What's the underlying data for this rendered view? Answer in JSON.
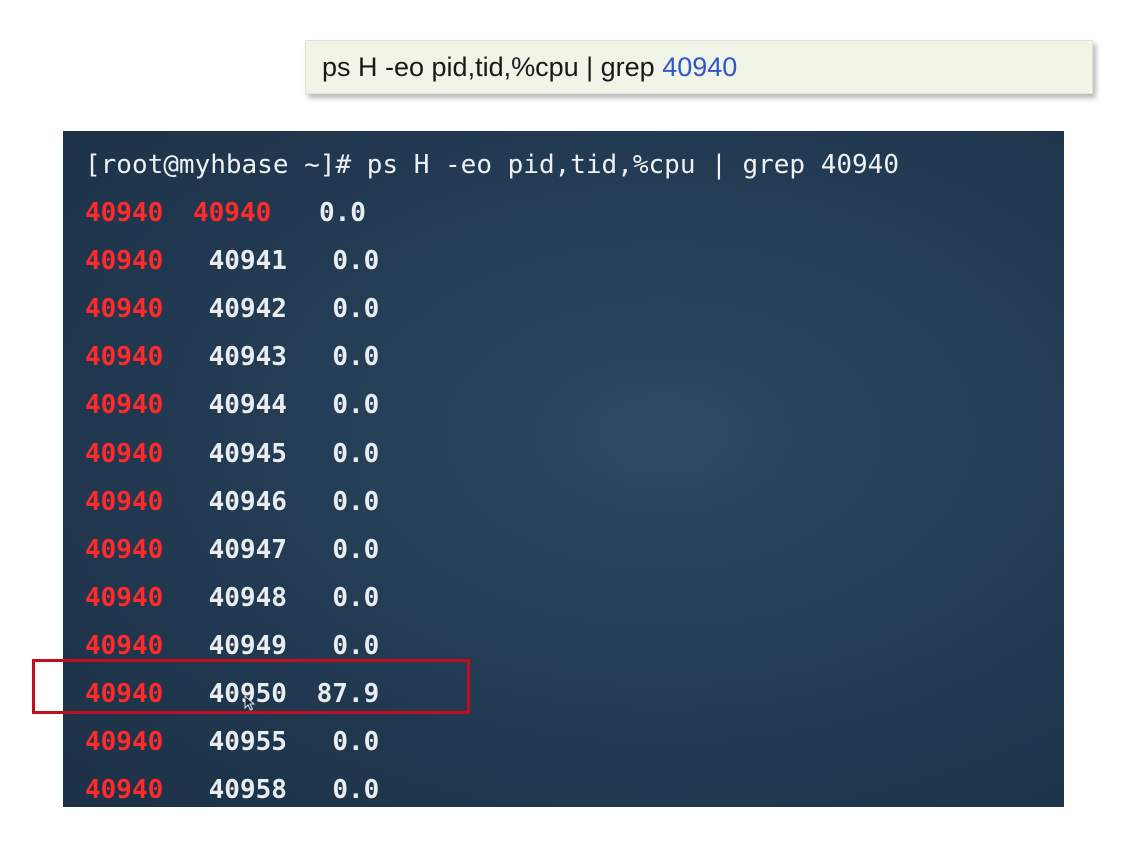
{
  "command_box": {
    "prefix": "ps H -eo pid,tid,%cpu | grep ",
    "highlight": "40940"
  },
  "terminal": {
    "prompt": "[root@myhbase ~]# ps H -eo pid,tid,%cpu | grep 40940",
    "rows": [
      {
        "pid": "40940",
        "tid": "40940",
        "cpu": "0.0",
        "tid_red": true
      },
      {
        "pid": "40940",
        "tid": "40941",
        "cpu": "0.0"
      },
      {
        "pid": "40940",
        "tid": "40942",
        "cpu": "0.0"
      },
      {
        "pid": "40940",
        "tid": "40943",
        "cpu": "0.0"
      },
      {
        "pid": "40940",
        "tid": "40944",
        "cpu": "0.0"
      },
      {
        "pid": "40940",
        "tid": "40945",
        "cpu": "0.0"
      },
      {
        "pid": "40940",
        "tid": "40946",
        "cpu": "0.0"
      },
      {
        "pid": "40940",
        "tid": "40947",
        "cpu": "0.0"
      },
      {
        "pid": "40940",
        "tid": "40948",
        "cpu": "0.0"
      },
      {
        "pid": "40940",
        "tid": "40949",
        "cpu": "0.0"
      },
      {
        "pid": "40940",
        "tid": "40950",
        "cpu": "87.9"
      },
      {
        "pid": "40940",
        "tid": "40955",
        "cpu": "0.0"
      },
      {
        "pid": "40940",
        "tid": "40958",
        "cpu": "0.0"
      }
    ]
  },
  "colors": {
    "pid_red": "#ff2a2a",
    "highlight_blue": "#2f57c9",
    "selection_red": "#c0101e"
  },
  "icons": {
    "cursor": "mouse-pointer-icon"
  }
}
